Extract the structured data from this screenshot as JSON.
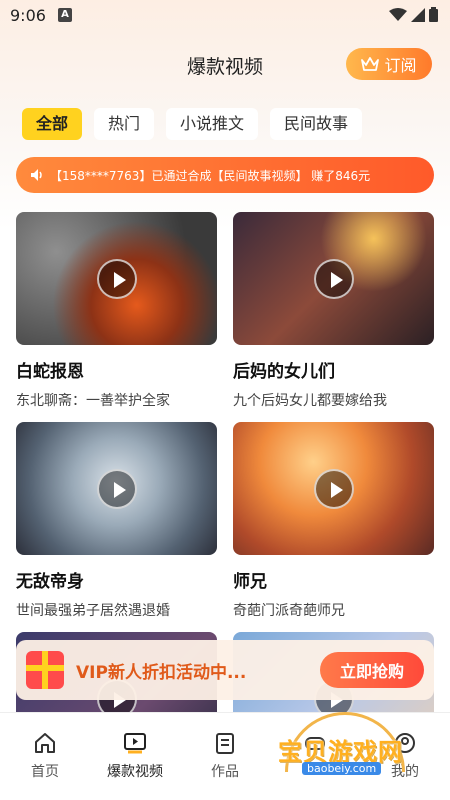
{
  "status_bar": {
    "time": "9:06",
    "a_badge": "A"
  },
  "header": {
    "title": "爆款视频",
    "subscribe_label": "订阅"
  },
  "tabs": [
    {
      "label": "全部",
      "active": true
    },
    {
      "label": "热门",
      "active": false
    },
    {
      "label": "小说推文",
      "active": false
    },
    {
      "label": "民间故事",
      "active": false
    }
  ],
  "ticker": {
    "text": "【158****7763】已通过合成【民间故事视频】 赚了846元"
  },
  "videos": [
    {
      "title": "白蛇报恩",
      "subtitle": "东北聊斋：一善举护全家"
    },
    {
      "title": "后妈的女儿们",
      "subtitle": "九个后妈女儿都要嫁给我"
    },
    {
      "title": "无敌帝身",
      "subtitle": "世间最强弟子居然遇退婚"
    },
    {
      "title": "师兄",
      "subtitle": "奇葩门派奇葩师兄"
    }
  ],
  "vip_banner": {
    "text": "VIP新人折扣活动中...",
    "button": "立即抢购"
  },
  "bottom_nav": [
    {
      "label": "首页",
      "icon": "home-icon"
    },
    {
      "label": "爆款视频",
      "icon": "video-icon"
    },
    {
      "label": "作品",
      "icon": "works-icon"
    },
    {
      "label": "",
      "icon": ""
    },
    {
      "label": "我的",
      "icon": "profile-icon"
    }
  ],
  "watermark": {
    "text": "宝贝游戏网",
    "url": "baobeiy.com"
  },
  "colors": {
    "accent": "#ff7a2b",
    "tab_active": "#ffd21f",
    "ticker": "#ff6a2f"
  }
}
